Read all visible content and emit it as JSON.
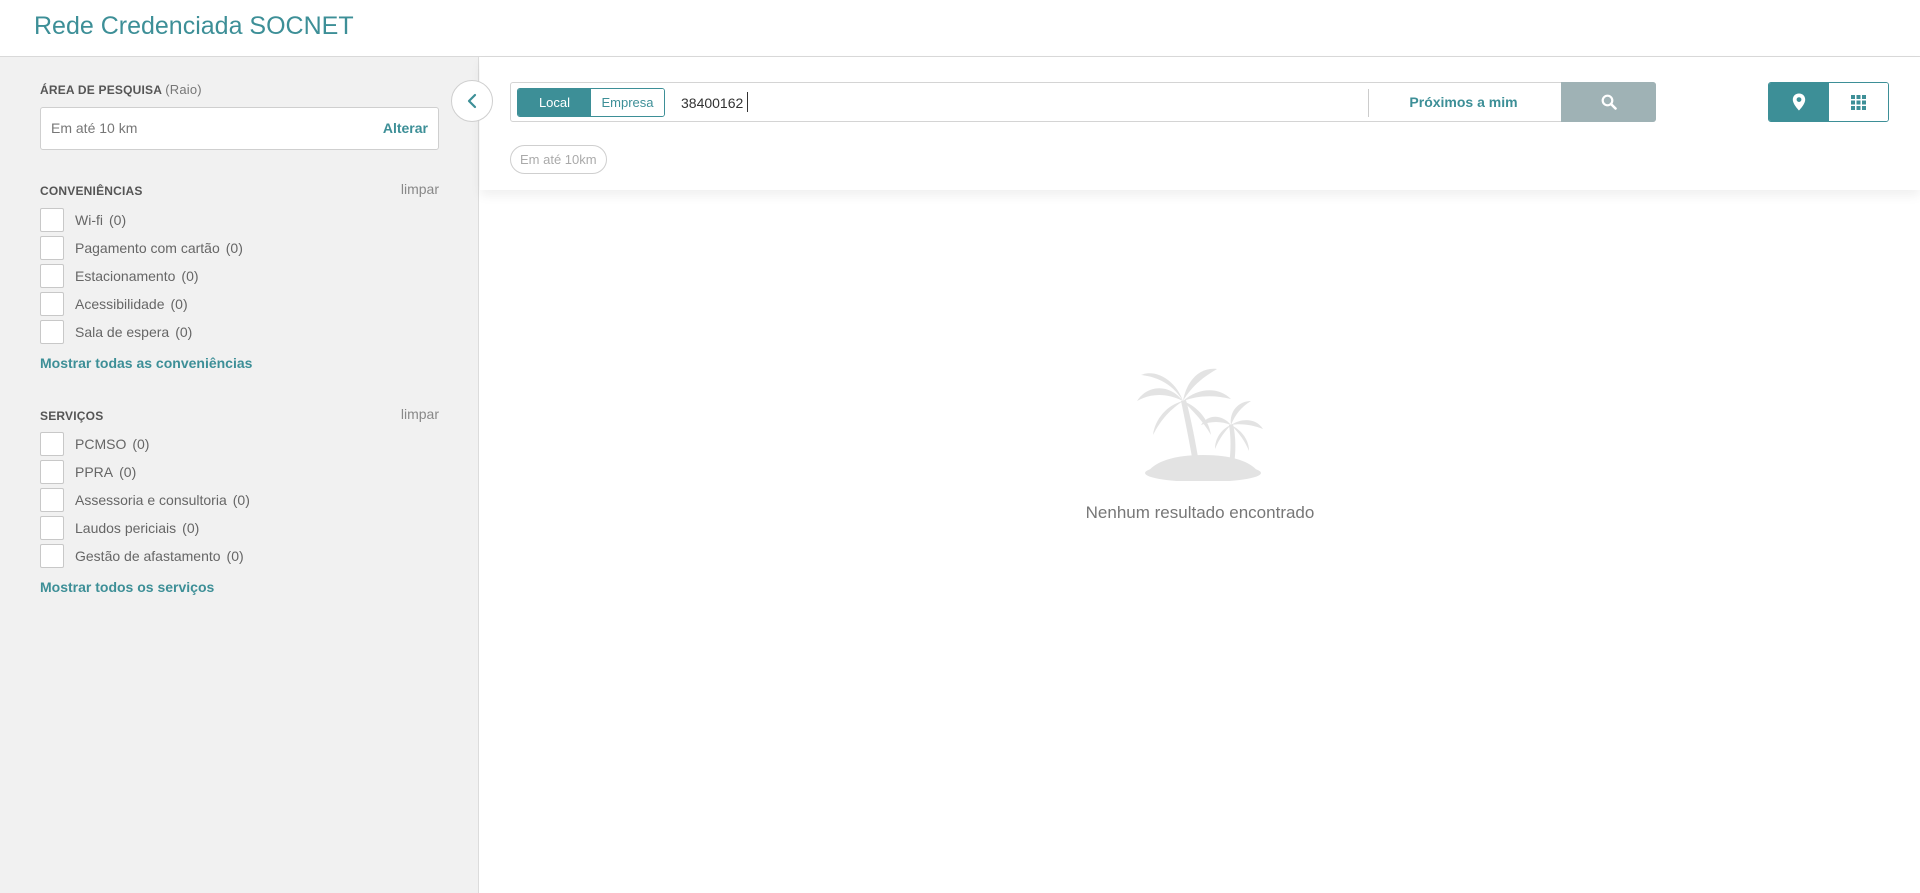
{
  "app": {
    "title": "Rede Credenciada SOCNET"
  },
  "search_area": {
    "title": "ÁREA DE PESQUISA",
    "subtitle": "(Raio)",
    "value": "Em até 10 km",
    "change_label": "Alterar"
  },
  "conveniencias": {
    "title": "CONVENIÊNCIAS",
    "clear_label": "limpar",
    "items": [
      {
        "label": "Wi-fi",
        "count": "(0)"
      },
      {
        "label": "Pagamento com cartão",
        "count": "(0)"
      },
      {
        "label": "Estacionamento",
        "count": "(0)"
      },
      {
        "label": "Acessibilidade",
        "count": "(0)"
      },
      {
        "label": "Sala de espera",
        "count": "(0)"
      }
    ],
    "show_all_label": "Mostrar todas as conveniências"
  },
  "servicos": {
    "title": "SERVIÇOS",
    "clear_label": "limpar",
    "items": [
      {
        "label": "PCMSO",
        "count": "(0)"
      },
      {
        "label": "PPRA",
        "count": "(0)"
      },
      {
        "label": "Assessoria e consultoria",
        "count": "(0)"
      },
      {
        "label": "Laudos periciais",
        "count": "(0)"
      },
      {
        "label": "Gestão de afastamento",
        "count": "(0)"
      }
    ],
    "show_all_label": "Mostrar todos os serviços"
  },
  "search": {
    "mode_options": [
      "Local",
      "Empresa"
    ],
    "active_mode": "Local",
    "query": "38400162",
    "nearby_label": "Próximos a mim",
    "filter_chip": "Em até 10km"
  },
  "view": {
    "options": [
      "map-view",
      "grid-view"
    ],
    "active": "map-view"
  },
  "results": {
    "empty_message": "Nenhum resultado encontrado"
  },
  "colors": {
    "accent": "#3d8f97",
    "search_button": "#9fb2b5",
    "sidebar_bg": "#f1f1f1"
  },
  "icons": [
    "chevron-left-icon",
    "search-icon",
    "map-pin-icon",
    "grid-icon",
    "palm-island-icon"
  ]
}
